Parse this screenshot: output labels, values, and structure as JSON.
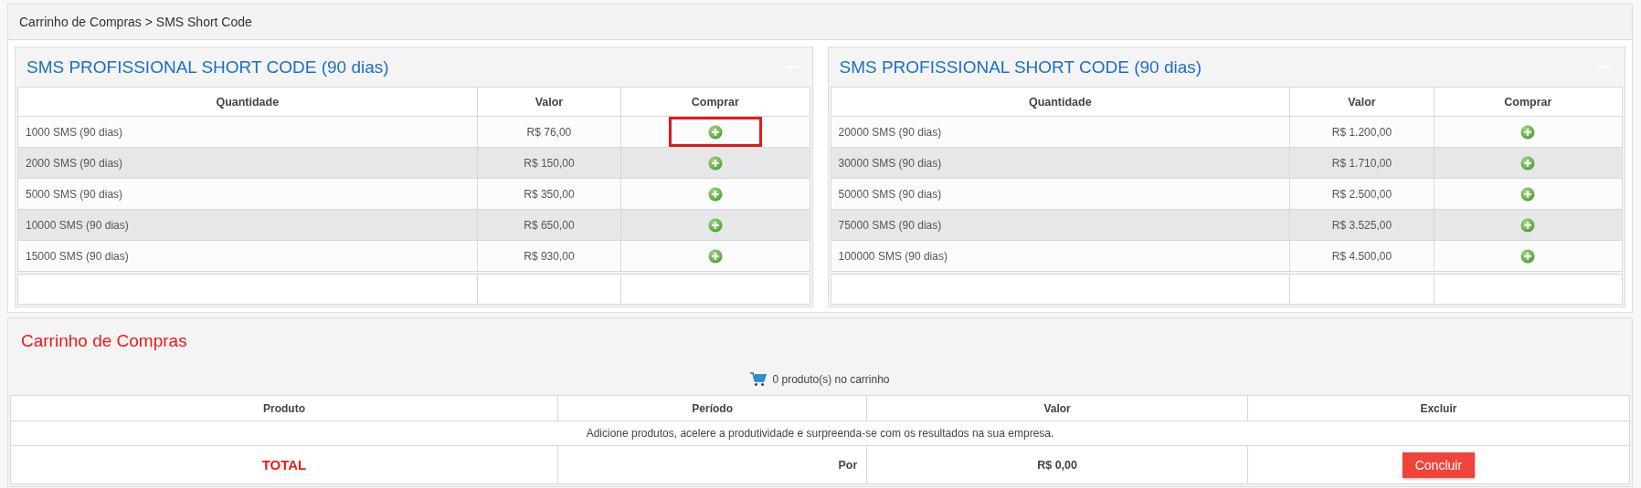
{
  "breadcrumb": "Carrinho de Compras > SMS Short Code",
  "panels": [
    {
      "title": "SMS PROFISSIONAL SHORT CODE (90 dias)",
      "columns": [
        "Quantidade",
        "Valor",
        "Comprar"
      ],
      "rows": [
        {
          "quantity": "1000 SMS (90 dias)",
          "price": "R$ 76,00",
          "highlighted": true
        },
        {
          "quantity": "2000 SMS (90 dias)",
          "price": "R$ 150,00",
          "highlighted": false
        },
        {
          "quantity": "5000 SMS (90 dias)",
          "price": "R$ 350,00",
          "highlighted": false
        },
        {
          "quantity": "10000 SMS (90 dias)",
          "price": "R$ 650,00",
          "highlighted": false
        },
        {
          "quantity": "15000 SMS (90 dias)",
          "price": "R$ 930,00",
          "highlighted": false
        }
      ]
    },
    {
      "title": "SMS PROFISSIONAL SHORT CODE (90 dias)",
      "columns": [
        "Quantidade",
        "Valor",
        "Comprar"
      ],
      "rows": [
        {
          "quantity": "20000 SMS (90 dias)",
          "price": "R$ 1.200,00",
          "highlighted": false
        },
        {
          "quantity": "30000 SMS (90 dias)",
          "price": "R$ 1.710,00",
          "highlighted": false
        },
        {
          "quantity": "50000 SMS (90 dias)",
          "price": "R$ 2.500,00",
          "highlighted": false
        },
        {
          "quantity": "75000 SMS (90 dias)",
          "price": "R$ 3.525,00",
          "highlighted": false
        },
        {
          "quantity": "100000 SMS (90 dias)",
          "price": "R$ 4.500,00",
          "highlighted": false
        }
      ]
    }
  ],
  "cart": {
    "title": "Carrinho de Compras",
    "summary": "0 produto(s) no carrinho",
    "columns": [
      "Produto",
      "Período",
      "Valor",
      "Excluir"
    ],
    "message": "Adicione produtos, acelere a produtividade e surpreenda-se com os resultados na sua empresa.",
    "total_label": "TOTAL",
    "per_label": "Por",
    "total_value": "R$ 0,00",
    "button": "Concluir"
  }
}
